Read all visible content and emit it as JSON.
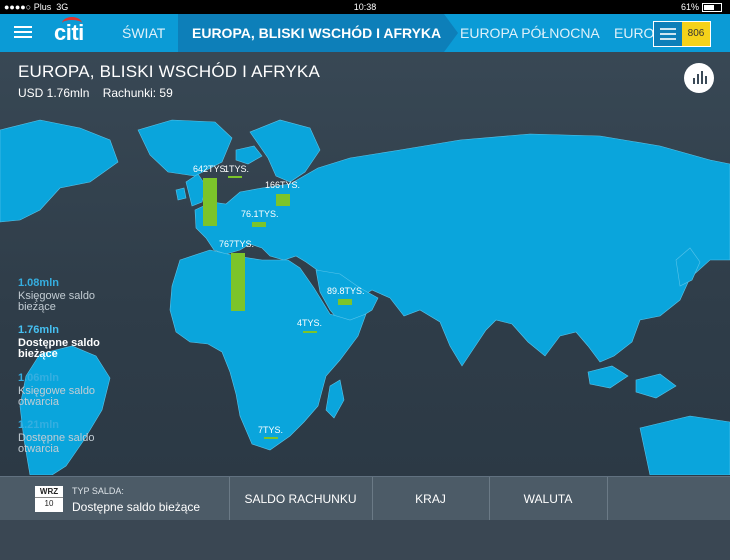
{
  "status": {
    "carrier": "Plus",
    "network": "3G",
    "time": "10:38",
    "battery": "61%"
  },
  "nav": {
    "logo": "citi",
    "tabs": [
      {
        "label": "ŚWIAT"
      },
      {
        "label": "EUROPA, BLISKI WSCHÓD I AFRYKA"
      },
      {
        "label": "EUROPA PÓŁNOCNA"
      },
      {
        "label": "EURO"
      }
    ],
    "toggle_count": "806"
  },
  "header": {
    "title": "EUROPA, BLISKI WSCHÓD I AFRYKA",
    "amount": "USD 1.76mln",
    "accounts": "Rachunki: 59"
  },
  "colors": {
    "nav": "#0b9bd6",
    "land": "#0aa5dc",
    "bar": "#7cc42a",
    "badge": "#f5d21a"
  },
  "map": {
    "bars": [
      {
        "label": "642TYS."
      },
      {
        "label": "1TYS."
      },
      {
        "label": "166TYS."
      },
      {
        "label": "76.1TYS."
      },
      {
        "label": "767TYS."
      },
      {
        "label": "89.8TYS."
      },
      {
        "label": "4TYS."
      },
      {
        "label": "7TYS."
      }
    ]
  },
  "legend": [
    {
      "value": "1.08mln",
      "label": "Księgowe saldo bieżące"
    },
    {
      "value": "1.76mln",
      "label": "Dostępne saldo bieżące"
    },
    {
      "value": "1.06mln",
      "label": "Księgowe saldo otwarcia"
    },
    {
      "value": "1.21mln",
      "label": "Dostępne saldo otwarcia"
    }
  ],
  "bottom": {
    "date_month": "WRZ",
    "date_day": "10",
    "saldo_label": "TYP SALDA:",
    "saldo_value": "Dostępne saldo bieżące",
    "buttons": [
      "SALDO RACHUNKU",
      "KRAJ",
      "WALUTA"
    ]
  }
}
